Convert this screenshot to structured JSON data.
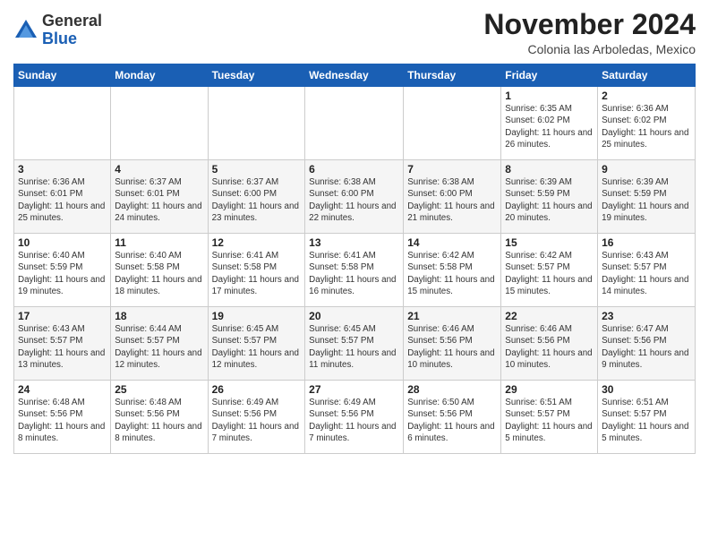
{
  "header": {
    "logo_general": "General",
    "logo_blue": "Blue",
    "title": "November 2024",
    "subtitle": "Colonia las Arboledas, Mexico"
  },
  "calendar": {
    "weekdays": [
      "Sunday",
      "Monday",
      "Tuesday",
      "Wednesday",
      "Thursday",
      "Friday",
      "Saturday"
    ],
    "weeks": [
      [
        {
          "day": "",
          "info": ""
        },
        {
          "day": "",
          "info": ""
        },
        {
          "day": "",
          "info": ""
        },
        {
          "day": "",
          "info": ""
        },
        {
          "day": "",
          "info": ""
        },
        {
          "day": "1",
          "info": "Sunrise: 6:35 AM\nSunset: 6:02 PM\nDaylight: 11 hours and 26 minutes."
        },
        {
          "day": "2",
          "info": "Sunrise: 6:36 AM\nSunset: 6:02 PM\nDaylight: 11 hours and 25 minutes."
        }
      ],
      [
        {
          "day": "3",
          "info": "Sunrise: 6:36 AM\nSunset: 6:01 PM\nDaylight: 11 hours and 25 minutes."
        },
        {
          "day": "4",
          "info": "Sunrise: 6:37 AM\nSunset: 6:01 PM\nDaylight: 11 hours and 24 minutes."
        },
        {
          "day": "5",
          "info": "Sunrise: 6:37 AM\nSunset: 6:00 PM\nDaylight: 11 hours and 23 minutes."
        },
        {
          "day": "6",
          "info": "Sunrise: 6:38 AM\nSunset: 6:00 PM\nDaylight: 11 hours and 22 minutes."
        },
        {
          "day": "7",
          "info": "Sunrise: 6:38 AM\nSunset: 6:00 PM\nDaylight: 11 hours and 21 minutes."
        },
        {
          "day": "8",
          "info": "Sunrise: 6:39 AM\nSunset: 5:59 PM\nDaylight: 11 hours and 20 minutes."
        },
        {
          "day": "9",
          "info": "Sunrise: 6:39 AM\nSunset: 5:59 PM\nDaylight: 11 hours and 19 minutes."
        }
      ],
      [
        {
          "day": "10",
          "info": "Sunrise: 6:40 AM\nSunset: 5:59 PM\nDaylight: 11 hours and 19 minutes."
        },
        {
          "day": "11",
          "info": "Sunrise: 6:40 AM\nSunset: 5:58 PM\nDaylight: 11 hours and 18 minutes."
        },
        {
          "day": "12",
          "info": "Sunrise: 6:41 AM\nSunset: 5:58 PM\nDaylight: 11 hours and 17 minutes."
        },
        {
          "day": "13",
          "info": "Sunrise: 6:41 AM\nSunset: 5:58 PM\nDaylight: 11 hours and 16 minutes."
        },
        {
          "day": "14",
          "info": "Sunrise: 6:42 AM\nSunset: 5:58 PM\nDaylight: 11 hours and 15 minutes."
        },
        {
          "day": "15",
          "info": "Sunrise: 6:42 AM\nSunset: 5:57 PM\nDaylight: 11 hours and 15 minutes."
        },
        {
          "day": "16",
          "info": "Sunrise: 6:43 AM\nSunset: 5:57 PM\nDaylight: 11 hours and 14 minutes."
        }
      ],
      [
        {
          "day": "17",
          "info": "Sunrise: 6:43 AM\nSunset: 5:57 PM\nDaylight: 11 hours and 13 minutes."
        },
        {
          "day": "18",
          "info": "Sunrise: 6:44 AM\nSunset: 5:57 PM\nDaylight: 11 hours and 12 minutes."
        },
        {
          "day": "19",
          "info": "Sunrise: 6:45 AM\nSunset: 5:57 PM\nDaylight: 11 hours and 12 minutes."
        },
        {
          "day": "20",
          "info": "Sunrise: 6:45 AM\nSunset: 5:57 PM\nDaylight: 11 hours and 11 minutes."
        },
        {
          "day": "21",
          "info": "Sunrise: 6:46 AM\nSunset: 5:56 PM\nDaylight: 11 hours and 10 minutes."
        },
        {
          "day": "22",
          "info": "Sunrise: 6:46 AM\nSunset: 5:56 PM\nDaylight: 11 hours and 10 minutes."
        },
        {
          "day": "23",
          "info": "Sunrise: 6:47 AM\nSunset: 5:56 PM\nDaylight: 11 hours and 9 minutes."
        }
      ],
      [
        {
          "day": "24",
          "info": "Sunrise: 6:48 AM\nSunset: 5:56 PM\nDaylight: 11 hours and 8 minutes."
        },
        {
          "day": "25",
          "info": "Sunrise: 6:48 AM\nSunset: 5:56 PM\nDaylight: 11 hours and 8 minutes."
        },
        {
          "day": "26",
          "info": "Sunrise: 6:49 AM\nSunset: 5:56 PM\nDaylight: 11 hours and 7 minutes."
        },
        {
          "day": "27",
          "info": "Sunrise: 6:49 AM\nSunset: 5:56 PM\nDaylight: 11 hours and 7 minutes."
        },
        {
          "day": "28",
          "info": "Sunrise: 6:50 AM\nSunset: 5:56 PM\nDaylight: 11 hours and 6 minutes."
        },
        {
          "day": "29",
          "info": "Sunrise: 6:51 AM\nSunset: 5:57 PM\nDaylight: 11 hours and 5 minutes."
        },
        {
          "day": "30",
          "info": "Sunrise: 6:51 AM\nSunset: 5:57 PM\nDaylight: 11 hours and 5 minutes."
        }
      ]
    ]
  }
}
